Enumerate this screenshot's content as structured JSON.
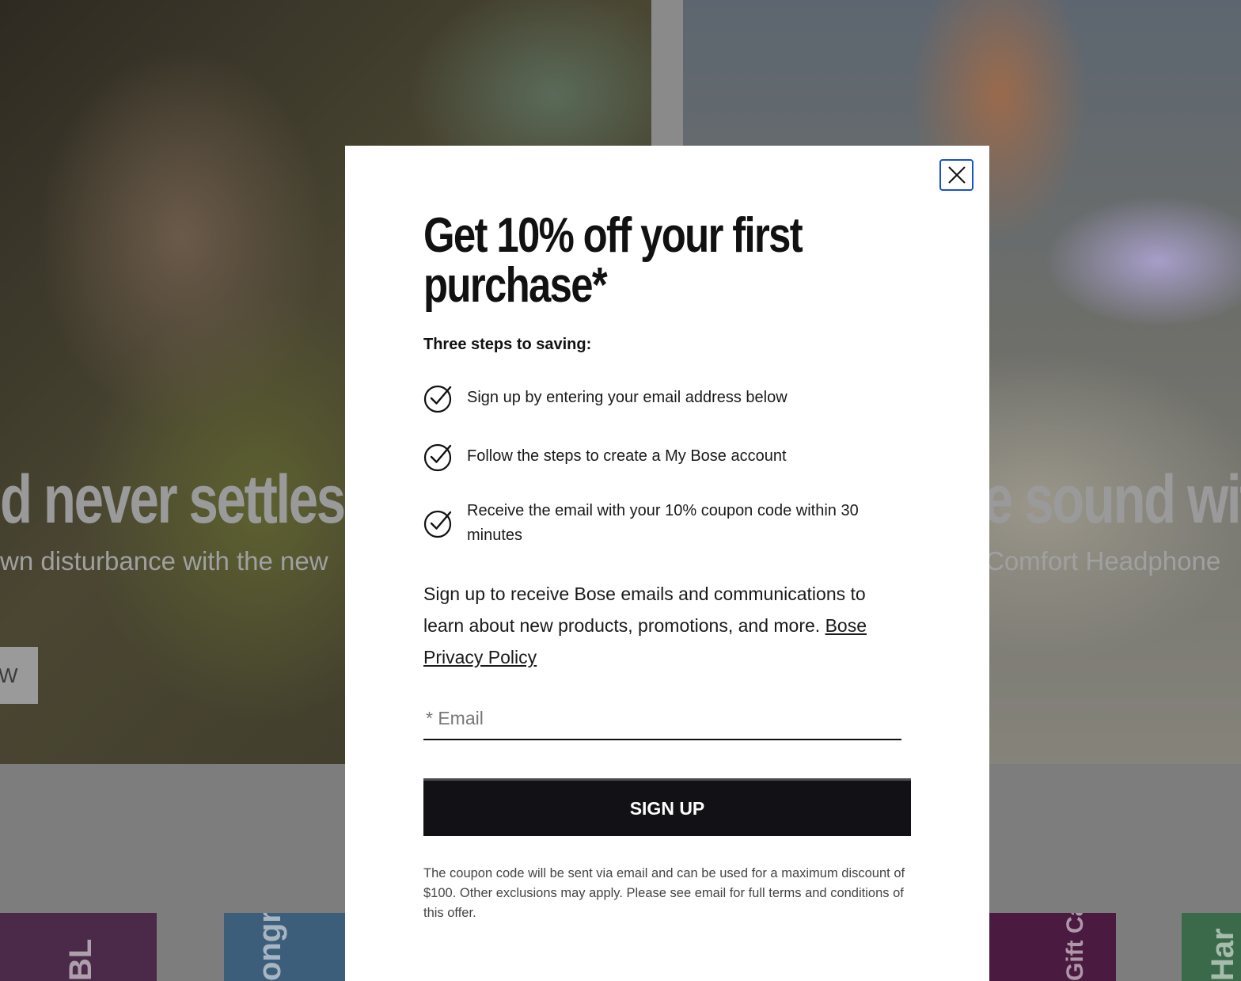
{
  "background": {
    "left_headline": "d never settles",
    "left_subtext": "wn disturbance with the new",
    "left_button": "W",
    "right_headline": "e sound wit",
    "right_subtext": "Comfort Headphone",
    "tiles": [
      "BL",
      "ongr",
      "Gift Ca",
      "Har"
    ]
  },
  "modal": {
    "close_icon": "close-icon",
    "title": "Get 10% off your first purchase*",
    "steps_label": "Three steps to saving:",
    "steps": [
      "Sign up by entering your email address below",
      "Follow the steps to create a My Bose account",
      "Receive the email with your 10% coupon code within 30 minutes"
    ],
    "consent_text": "Sign up to receive Bose emails and communications to learn about new products, promotions, and more.",
    "privacy_link": "Bose Privacy Policy",
    "email_placeholder": "* Email",
    "signup_label": "SIGN UP",
    "fineprint": "The coupon code will be sent via email and can be used for a maximum discount of $100. Other exclusions may apply. Please see email for full terms and conditions of this offer."
  },
  "colors": {
    "accent_focus": "#1b4fd1",
    "button_bg": "#111116",
    "overlay": "#7d7d7d"
  }
}
